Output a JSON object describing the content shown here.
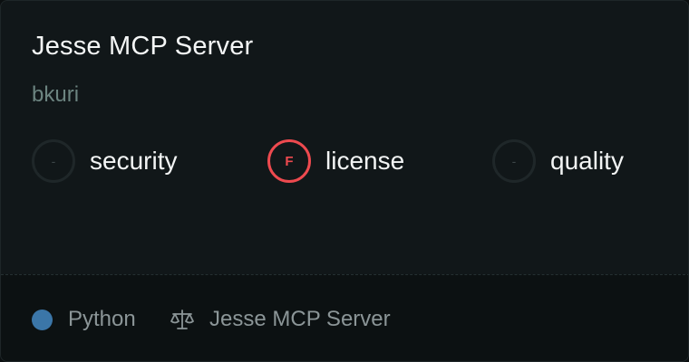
{
  "card": {
    "title": "Jesse MCP Server",
    "author": "bkuri"
  },
  "metrics": [
    {
      "grade": "-",
      "label": "security",
      "status": "none"
    },
    {
      "grade": "F",
      "label": "license",
      "status": "fail",
      "color": "#ee4a4f"
    },
    {
      "grade": "-",
      "label": "quality",
      "status": "none"
    }
  ],
  "footer": {
    "language": "Python",
    "language_color": "#3b76a8",
    "license_icon": "scale-icon",
    "license_name": "Jesse MCP Server"
  }
}
